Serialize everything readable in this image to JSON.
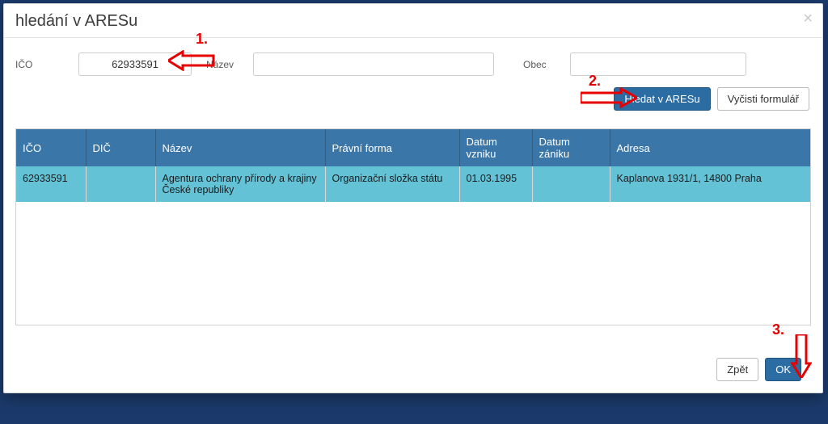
{
  "modal": {
    "title": "hledání v ARESu"
  },
  "labels": {
    "ico": "IČO",
    "nazev": "Název",
    "obec": "Obec"
  },
  "inputs": {
    "ico": "62933591",
    "nazev": "",
    "obec": ""
  },
  "buttons": {
    "search": "Hledat v ARESu",
    "clear": "Vyčisti formulář",
    "back": "Zpět",
    "ok": "OK"
  },
  "table": {
    "headers": {
      "ico": "IČO",
      "dic": "DIČ",
      "nazev": "Název",
      "forma": "Právní forma",
      "vznik": "Datum vzniku",
      "zanik": "Datum zániku",
      "adresa": "Adresa"
    },
    "rows": [
      {
        "ico": "62933591",
        "dic": "",
        "nazev": "Agentura ochrany přírody a krajiny České republiky",
        "forma": "Organizační složka státu",
        "vznik": "01.03.1995",
        "zanik": "",
        "adresa": "Kaplanova 1931/1, 14800 Praha"
      }
    ]
  },
  "annotations": {
    "n1": "1.",
    "n2": "2.",
    "n3": "3."
  }
}
